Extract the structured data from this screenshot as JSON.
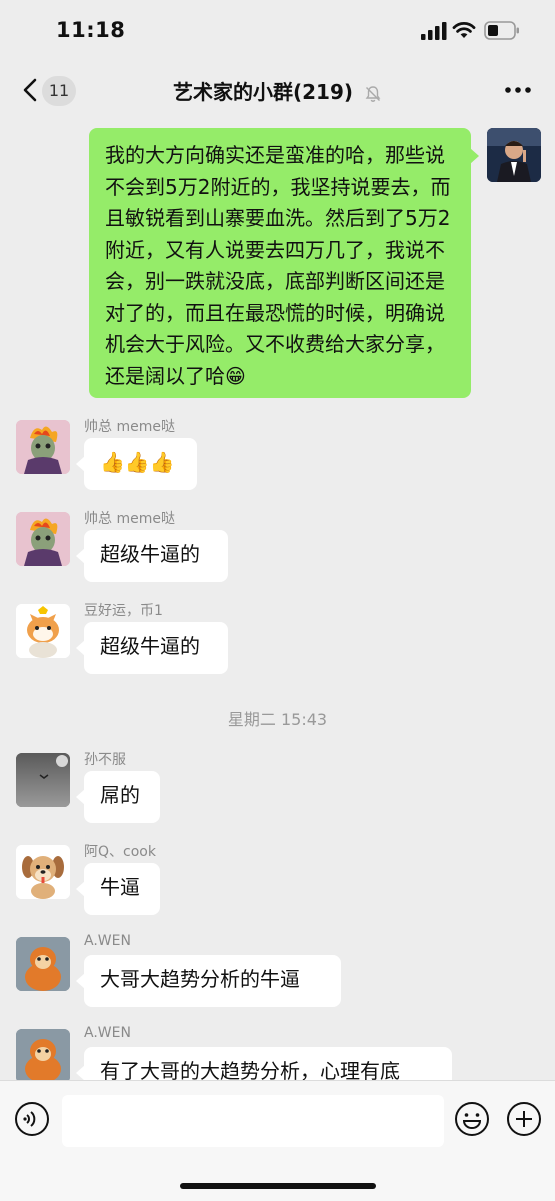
{
  "status_bar": {
    "time": "11:18"
  },
  "nav": {
    "unread_count": "11",
    "title": "艺术家的小群(219)"
  },
  "messages": [
    {
      "text": "我的大方向确实还是蛮准的哈，那些说不会到5万2附近的，我坚持说要去，而且敏锐看到山寨要血洗。然后到了5万2附近，又有人说要去四万几了，我说不会，别一跌就没底，底部判断区间还是对了的，而且在最恐慌的时候，明确说机会大于风险。又不收费给大家分享，还是阔以了哈😁"
    },
    {
      "sender": "帅总 meme哒",
      "text": "👍👍👍"
    },
    {
      "sender": "帅总 meme哒",
      "text": "超级牛逼的"
    },
    {
      "sender": "豆好运，币1",
      "text": "超级牛逼的"
    },
    {
      "sender": "孙不服",
      "text": "屌的"
    },
    {
      "sender": "阿Q、cook",
      "text": "牛逼"
    },
    {
      "sender": "A.WEN",
      "text": "大哥大趋势分析的牛逼"
    },
    {
      "sender": "A.WEN",
      "text": "有了大哥的大趋势分析，心理有底"
    }
  ],
  "timestamp": "星期二 15:43",
  "colors": {
    "self_bubble": "#95ec69",
    "other_bubble": "#ffffff",
    "background": "#ededed"
  },
  "icons": [
    "back-chevron-icon",
    "mute-bell-icon",
    "more-icon",
    "voice-icon",
    "emoji-icon",
    "plus-icon"
  ]
}
